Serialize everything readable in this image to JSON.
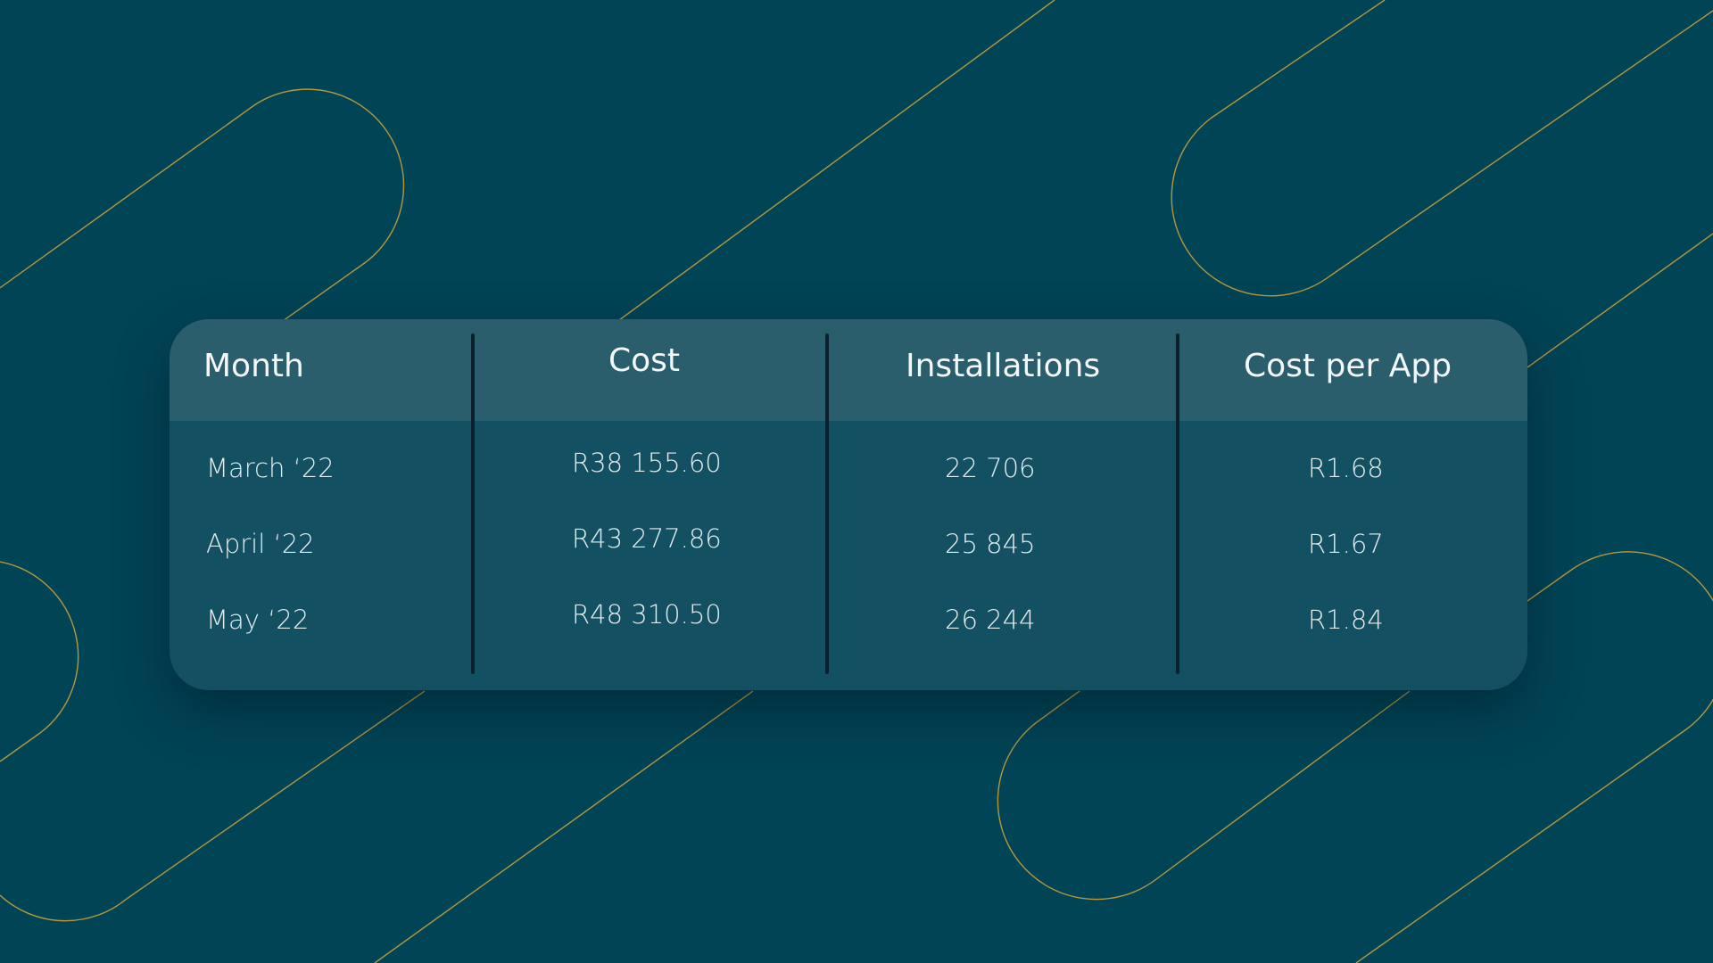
{
  "chart_data": {
    "type": "table",
    "columns": [
      "Month",
      "Cost",
      "Installations",
      "Cost per App"
    ],
    "rows": [
      [
        "March ‘22",
        "R38 155.60",
        "22 706",
        "R1.68"
      ],
      [
        "April ‘22",
        "R43 277.86",
        "25 845",
        "R1.67"
      ],
      [
        "May ‘22",
        "R48 310.50",
        "26 244",
        "R1.84"
      ]
    ]
  },
  "colors": {
    "background": "#014456",
    "card": "#135162",
    "header": "#2b5e6d",
    "accent_lines": "#c9a23a"
  }
}
